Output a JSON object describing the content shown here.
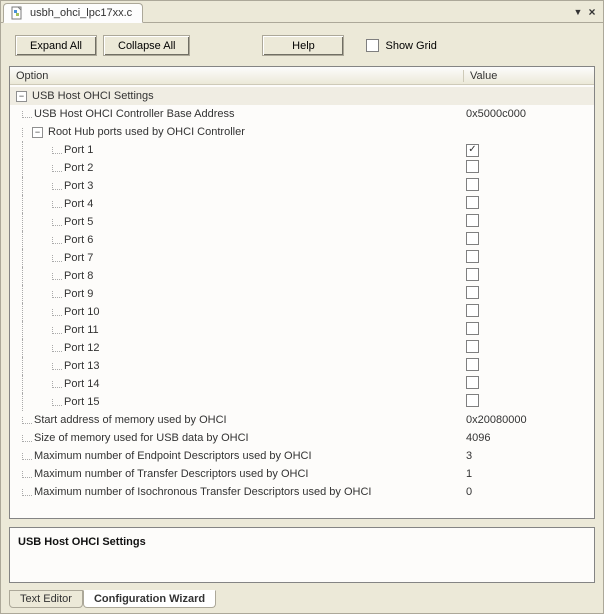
{
  "tab": {
    "filename": "usbh_ohci_lpc17xx.c"
  },
  "toolbar": {
    "expand_all": "Expand All",
    "collapse_all": "Collapse All",
    "help": "Help",
    "show_grid_label": "Show Grid"
  },
  "columns": {
    "option": "Option",
    "value": "Value"
  },
  "tree": {
    "root": {
      "label": "USB Host OHCI Settings"
    },
    "ctrl_base": {
      "label": "USB Host OHCI Controller Base Address",
      "value": "0x5000c000"
    },
    "root_hub": {
      "label": "Root Hub ports used by OHCI Controller"
    },
    "ports": [
      {
        "label": "Port 1",
        "checked": true
      },
      {
        "label": "Port 2",
        "checked": false
      },
      {
        "label": "Port 3",
        "checked": false
      },
      {
        "label": "Port 4",
        "checked": false
      },
      {
        "label": "Port 5",
        "checked": false
      },
      {
        "label": "Port 6",
        "checked": false
      },
      {
        "label": "Port 7",
        "checked": false
      },
      {
        "label": "Port 8",
        "checked": false
      },
      {
        "label": "Port 9",
        "checked": false
      },
      {
        "label": "Port 10",
        "checked": false
      },
      {
        "label": "Port 11",
        "checked": false
      },
      {
        "label": "Port 12",
        "checked": false
      },
      {
        "label": "Port 13",
        "checked": false
      },
      {
        "label": "Port 14",
        "checked": false
      },
      {
        "label": "Port 15",
        "checked": false
      }
    ],
    "mem_start": {
      "label": "Start address of memory used by OHCI",
      "value": "0x20080000"
    },
    "mem_size": {
      "label": "Size of memory used for USB data by OHCI",
      "value": "4096"
    },
    "max_ed": {
      "label": "Maximum number of Endpoint Descriptors used by OHCI",
      "value": "3"
    },
    "max_td": {
      "label": "Maximum number of Transfer Descriptors used by OHCI",
      "value": "1"
    },
    "max_itd": {
      "label": "Maximum number of Isochronous Transfer Descriptors used by OHCI",
      "value": "0"
    }
  },
  "statusbox": {
    "title": "USB Host OHCI Settings"
  },
  "bottom_tabs": {
    "text_editor": "Text Editor",
    "config_wizard": "Configuration Wizard"
  }
}
